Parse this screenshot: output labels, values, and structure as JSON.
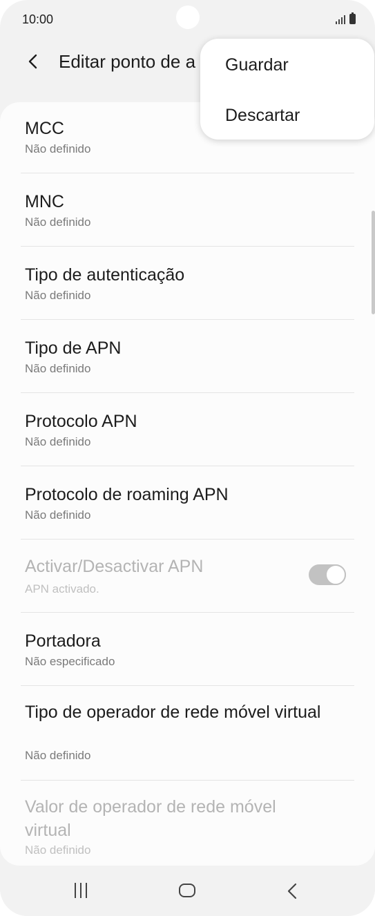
{
  "status_bar": {
    "time": "10:00",
    "icons": [
      "signal-icon",
      "battery-icon"
    ]
  },
  "header": {
    "back_icon": "back-arrow-icon",
    "title": "Editar ponto de a"
  },
  "menu": {
    "items": [
      {
        "label": "Guardar"
      },
      {
        "label": "Descartar"
      }
    ]
  },
  "list": {
    "items": [
      {
        "title": "MCC",
        "subtitle": "Não definido",
        "enabled": true
      },
      {
        "title": "MNC",
        "subtitle": "Não definido",
        "enabled": true
      },
      {
        "title": "Tipo de autenticação",
        "subtitle": "Não definido",
        "enabled": true
      },
      {
        "title": "Tipo de APN",
        "subtitle": "Não definido",
        "enabled": true
      },
      {
        "title": "Protocolo APN",
        "subtitle": "Não definido",
        "enabled": true
      },
      {
        "title": "Protocolo de roaming APN",
        "subtitle": "Não definido",
        "enabled": true
      },
      {
        "title": "Activar/Desactivar APN",
        "subtitle": "APN activado.",
        "enabled": false,
        "toggle_on": true
      },
      {
        "title": "Portadora",
        "subtitle": "Não especificado",
        "enabled": true
      },
      {
        "title": "Tipo de operador de rede móvel virtual",
        "subtitle": "Não definido",
        "enabled": true
      },
      {
        "title": "Valor de operador de rede móvel virtual",
        "subtitle": "Não definido",
        "enabled": false
      }
    ]
  },
  "nav_bar": {
    "icons": [
      "recents-icon",
      "home-icon",
      "back-icon"
    ]
  },
  "colors": {
    "background": "#f2f2f2",
    "card": "#fcfcfc",
    "text_primary": "#1c1c1c",
    "text_secondary": "#7a7a7a",
    "text_disabled": "#b4b4b4",
    "toggle_disabled": "#c2c2c2"
  }
}
